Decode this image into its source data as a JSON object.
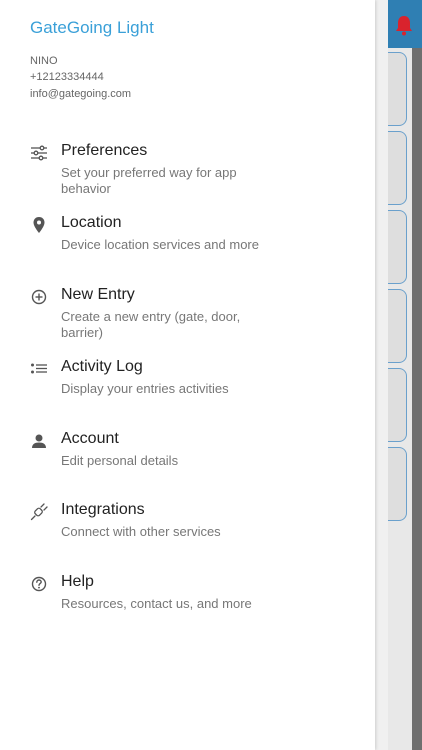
{
  "drawer": {
    "app_title": "GateGoing Light",
    "user": {
      "name": "NINO",
      "phone": "+12123334444",
      "email": "info@gategoing.com"
    },
    "items": [
      {
        "label": "Preferences",
        "description": "Set your preferred way for app behavior",
        "icon": "sliders-icon"
      },
      {
        "label": "Location",
        "description": "Device location services and more",
        "icon": "location-pin-icon"
      },
      {
        "label": "New Entry",
        "description": "Create a new entry (gate, door, barrier)",
        "icon": "add-circle-icon"
      },
      {
        "label": "Activity Log",
        "description": "Display your entries activities",
        "icon": "list-icon"
      },
      {
        "label": "Account",
        "description": "Edit personal details",
        "icon": "person-icon"
      },
      {
        "label": "Integrations",
        "description": "Connect with other services",
        "icon": "plug-icon"
      },
      {
        "label": "Help",
        "description": "Resources, contact us, and more",
        "icon": "help-icon"
      }
    ]
  },
  "colors": {
    "accent": "#3aa0d8",
    "header_bar": "#2f7fb3",
    "notification_bell": "#d9232d"
  }
}
